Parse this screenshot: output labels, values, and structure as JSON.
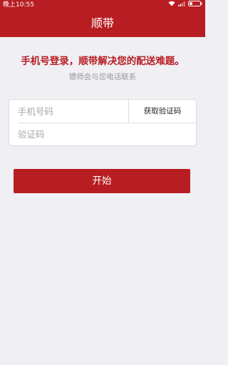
{
  "status_bar": {
    "time": "晚上10:55",
    "wifi_icon": "wifi-icon",
    "signal_icon": "signal-icon",
    "battery_icon": "battery-icon"
  },
  "header": {
    "title": "顺带"
  },
  "intro": {
    "headline": "手机号登录，顺带解决您的配送难题。",
    "subline": "镖师会与您电话联系"
  },
  "form": {
    "phone_placeholder": "手机号码",
    "phone_value": "",
    "get_code_label": "获取验证码",
    "code_placeholder": "验证码",
    "code_value": ""
  },
  "actions": {
    "start_label": "开始"
  },
  "colors": {
    "brand_red": "#b81d22",
    "background": "#efeff4"
  }
}
